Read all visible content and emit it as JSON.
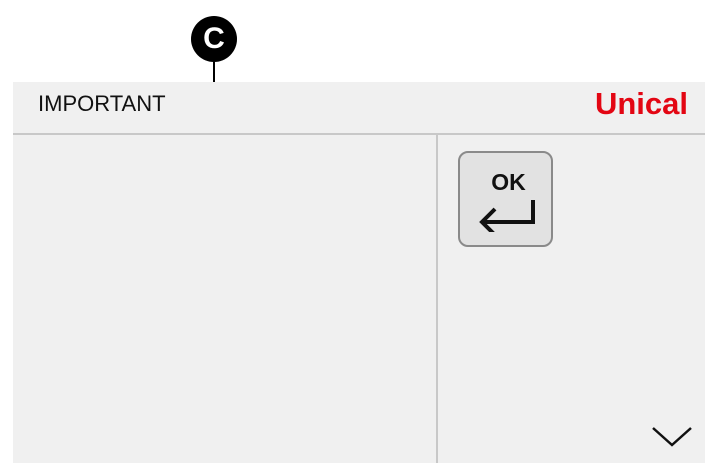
{
  "callout": {
    "letter": "C"
  },
  "header": {
    "title": "IMPORTANT",
    "brand": "Unical"
  },
  "ok_button": {
    "label": "OK",
    "icon": "enter-return-icon"
  },
  "navigation": {
    "scroll_down_icon": "chevron-down-icon"
  },
  "colors": {
    "brand": "#e30613",
    "panel_background": "#f0f0f0",
    "divider": "#c8c8c8",
    "button_background": "#e2e2e2",
    "callout": "#000000"
  }
}
